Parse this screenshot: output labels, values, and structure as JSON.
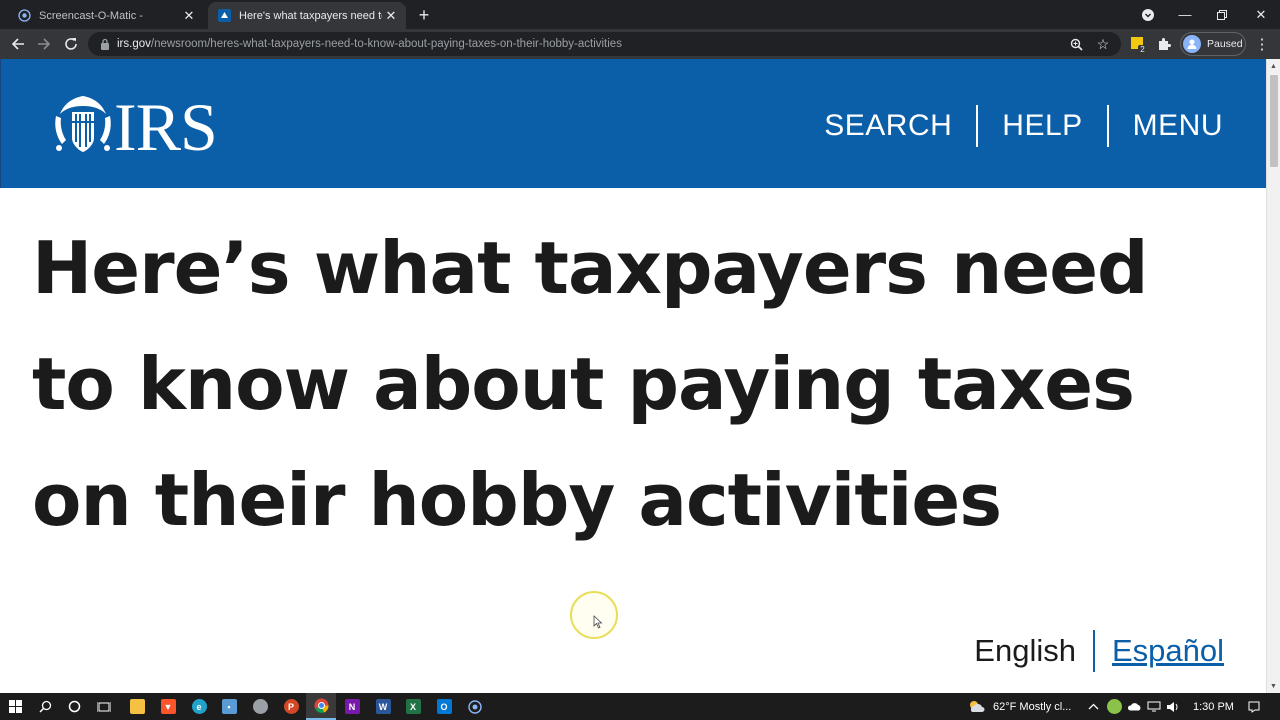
{
  "browser": {
    "tabs": [
      {
        "title": "Screencast-O-Matic -",
        "active": false
      },
      {
        "title": "Here's what taxpayers need to know about paying taxes on their hobby activities",
        "active": true
      }
    ],
    "url_host": "irs.gov",
    "url_path": "/newsroom/heres-what-taxpayers-need-to-know-about-paying-taxes-on-their-hobby-activities",
    "profile_label": "Paused",
    "extension_badge": "2"
  },
  "site": {
    "logo_text": "IRS",
    "nav": {
      "search": "SEARCH",
      "help": "HELP",
      "menu": "MENU"
    },
    "brand_color": "#0b5ea8"
  },
  "article": {
    "headline": "Here’s what taxpayers need to know about paying taxes on their hobby activities"
  },
  "language": {
    "current": "English",
    "alternate": "Español"
  },
  "taskbar": {
    "weather": "62°F  Mostly cl...",
    "time": "1:30 PM"
  }
}
